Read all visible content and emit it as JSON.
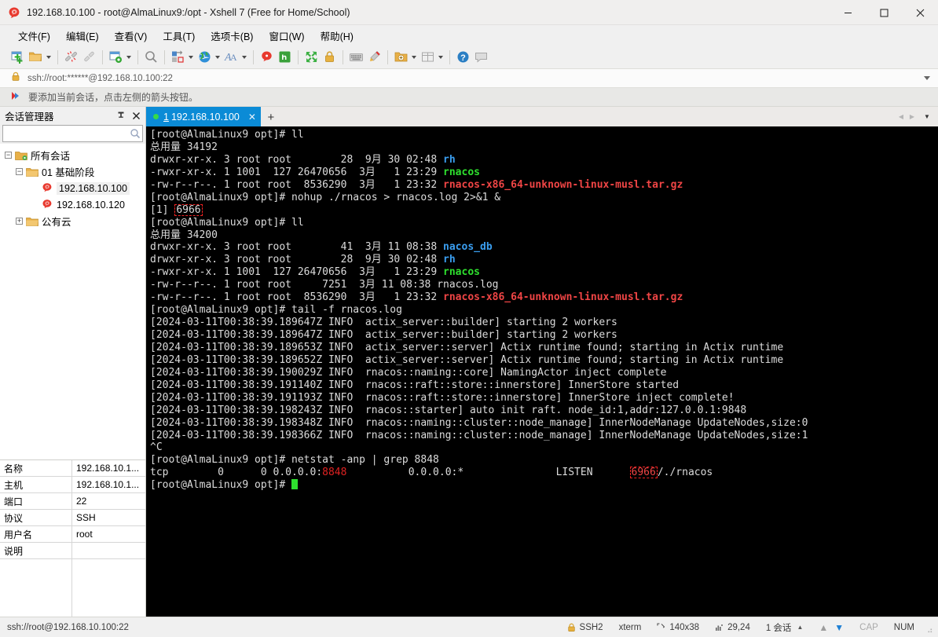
{
  "window": {
    "title": "192.168.10.100 - root@AlmaLinux9:/opt - Xshell 7 (Free for Home/School)",
    "minimize": "—",
    "maximize": "▢",
    "close": "✕"
  },
  "menubar": {
    "items": [
      {
        "label": "文件(F)",
        "name": "menu-file"
      },
      {
        "label": "编辑(E)",
        "name": "menu-edit"
      },
      {
        "label": "查看(V)",
        "name": "menu-view"
      },
      {
        "label": "工具(T)",
        "name": "menu-tools"
      },
      {
        "label": "选项卡(B)",
        "name": "menu-tabs"
      },
      {
        "label": "窗口(W)",
        "name": "menu-window"
      },
      {
        "label": "帮助(H)",
        "name": "menu-help"
      }
    ]
  },
  "toolbar": {
    "icons": [
      "new-session-icon",
      "open-folder-icon",
      "disconnect-icon",
      "reconnect-icon",
      "session-properties-icon",
      "find-icon",
      "transfer-icon",
      "globe-icon",
      "font-icon",
      "xshell-icon",
      "xftp-icon",
      "fullscreen-icon",
      "lock-icon",
      "keyboard-icon",
      "highlight-icon",
      "add-to-folder-icon",
      "layout-icon",
      "help-icon",
      "feedback-icon"
    ]
  },
  "address_bar": {
    "value": "ssh://root:******@192.168.10.100:22",
    "lock_icon": "lock-icon"
  },
  "notice_bar": {
    "text": "要添加当前会话，点击左侧的箭头按钮。",
    "icon": "red-arrow-icon"
  },
  "session_manager": {
    "title": "会话管理器",
    "pin_label": "⊓",
    "close_label": "✕",
    "search_placeholder": "",
    "search_value": "",
    "tree": [
      {
        "label": "所有会话",
        "type": "root-folder",
        "expander": "−",
        "name": "tree-node-all-sessions"
      },
      {
        "label": "01 基础阶段",
        "type": "folder",
        "expander": "−",
        "name": "tree-node-basic-stage"
      },
      {
        "label": "192.168.10.100",
        "type": "session",
        "expander": "",
        "selected": true,
        "name": "tree-node-session-100"
      },
      {
        "label": "192.168.10.120",
        "type": "session",
        "expander": "",
        "selected": false,
        "name": "tree-node-session-120"
      },
      {
        "label": "公有云",
        "type": "folder",
        "expander": "+",
        "name": "tree-node-public-cloud"
      }
    ],
    "properties": [
      {
        "key": "名称",
        "value": "192.168.10.1..."
      },
      {
        "key": "主机",
        "value": "192.168.10.1..."
      },
      {
        "key": "端口",
        "value": "22"
      },
      {
        "key": "协议",
        "value": "SSH"
      },
      {
        "key": "用户名",
        "value": "root"
      },
      {
        "key": "说明",
        "value": ""
      }
    ]
  },
  "tabs": {
    "active": {
      "number": "1",
      "label": "192.168.10.100",
      "close": "✕"
    },
    "add_label": "+",
    "left_arrow": "◀",
    "right_arrow": "▶",
    "dropdown": "▼"
  },
  "terminal": {
    "lines": [
      {
        "segs": [
          {
            "t": "[root@AlmaLinux9 opt]# ll",
            "c": "c-white"
          }
        ]
      },
      {
        "segs": [
          {
            "t": "总用量 34192",
            "c": "c-white"
          }
        ]
      },
      {
        "segs": [
          {
            "t": "drwxr-xr-x. 3 root root        28  9月 30 02:48 ",
            "c": "c-white"
          },
          {
            "t": "rh",
            "c": "c-blue"
          }
        ]
      },
      {
        "segs": [
          {
            "t": "-rwxr-xr-x. 1 1001  127 26470656  3月   1 23:29 ",
            "c": "c-white"
          },
          {
            "t": "rnacos",
            "c": "c-green"
          }
        ]
      },
      {
        "segs": [
          {
            "t": "-rw-r--r--. 1 root root  8536290  3月   1 23:32 ",
            "c": "c-white"
          },
          {
            "t": "rnacos-x86_64-unknown-linux-musl.tar.gz",
            "c": "c-red"
          }
        ]
      },
      {
        "segs": [
          {
            "t": "[root@AlmaLinux9 opt]# nohup ./rnacos > rnacos.log 2>&1 &",
            "c": "c-white"
          }
        ]
      },
      {
        "segs": [
          {
            "t": "[1] ",
            "c": "c-white"
          },
          {
            "t": "6966",
            "c": "c-white",
            "box": true
          }
        ]
      },
      {
        "segs": [
          {
            "t": "[root@AlmaLinux9 opt]# ll",
            "c": "c-white"
          }
        ]
      },
      {
        "segs": [
          {
            "t": "总用量 34200",
            "c": "c-white"
          }
        ]
      },
      {
        "segs": [
          {
            "t": "drwxr-xr-x. 3 root root        41  3月 11 08:38 ",
            "c": "c-white"
          },
          {
            "t": "nacos_db",
            "c": "c-blue"
          }
        ]
      },
      {
        "segs": [
          {
            "t": "drwxr-xr-x. 3 root root        28  9月 30 02:48 ",
            "c": "c-white"
          },
          {
            "t": "rh",
            "c": "c-blue"
          }
        ]
      },
      {
        "segs": [
          {
            "t": "-rwxr-xr-x. 1 1001  127 26470656  3月   1 23:29 ",
            "c": "c-white"
          },
          {
            "t": "rnacos",
            "c": "c-green"
          }
        ]
      },
      {
        "segs": [
          {
            "t": "-rw-r--r--. 1 root root     7251  3月 11 08:38 rnacos.log",
            "c": "c-white"
          }
        ]
      },
      {
        "segs": [
          {
            "t": "-rw-r--r--. 1 root root  8536290  3月   1 23:32 ",
            "c": "c-white"
          },
          {
            "t": "rnacos-x86_64-unknown-linux-musl.tar.gz",
            "c": "c-red"
          }
        ]
      },
      {
        "segs": [
          {
            "t": "[root@AlmaLinux9 opt]# tail -f rnacos.log",
            "c": "c-white"
          }
        ]
      },
      {
        "segs": [
          {
            "t": "[2024-03-11T00:38:39.189647Z INFO  actix_server::builder] starting 2 workers",
            "c": "c-white"
          }
        ]
      },
      {
        "segs": [
          {
            "t": "[2024-03-11T00:38:39.189647Z INFO  actix_server::builder] starting 2 workers",
            "c": "c-white"
          }
        ]
      },
      {
        "segs": [
          {
            "t": "[2024-03-11T00:38:39.189653Z INFO  actix_server::server] Actix runtime found; starting in Actix runtime",
            "c": "c-white"
          }
        ]
      },
      {
        "segs": [
          {
            "t": "[2024-03-11T00:38:39.189652Z INFO  actix_server::server] Actix runtime found; starting in Actix runtime",
            "c": "c-white"
          }
        ]
      },
      {
        "segs": [
          {
            "t": "[2024-03-11T00:38:39.190029Z INFO  rnacos::naming::core] NamingActor inject complete",
            "c": "c-white"
          }
        ]
      },
      {
        "segs": [
          {
            "t": "[2024-03-11T00:38:39.191140Z INFO  rnacos::raft::store::innerstore] InnerStore started",
            "c": "c-white"
          }
        ]
      },
      {
        "segs": [
          {
            "t": "[2024-03-11T00:38:39.191193Z INFO  rnacos::raft::store::innerstore] InnerStore inject complete!",
            "c": "c-white"
          }
        ]
      },
      {
        "segs": [
          {
            "t": "[2024-03-11T00:38:39.198243Z INFO  rnacos::starter] auto init raft. node_id:1,addr:127.0.0.1:9848",
            "c": "c-white"
          }
        ]
      },
      {
        "segs": [
          {
            "t": "[2024-03-11T00:38:39.198348Z INFO  rnacos::naming::cluster::node_manage] InnerNodeManage UpdateNodes,size:0",
            "c": "c-white"
          }
        ]
      },
      {
        "segs": [
          {
            "t": "[2024-03-11T00:38:39.198366Z INFO  rnacos::naming::cluster::node_manage] InnerNodeManage UpdateNodes,size:1",
            "c": "c-white"
          }
        ]
      },
      {
        "segs": [
          {
            "t": "^C",
            "c": "c-white"
          }
        ]
      },
      {
        "segs": [
          {
            "t": "[root@AlmaLinux9 opt]# netstat -anp | grep 8848",
            "c": "c-white"
          }
        ]
      },
      {
        "segs": [
          {
            "t": "tcp        0      0 0.0.0.0:",
            "c": "c-white"
          },
          {
            "t": "8848",
            "c": "c-redp"
          },
          {
            "t": "          0.0.0.0:*               LISTEN      ",
            "c": "c-white"
          },
          {
            "t": "6966",
            "c": "c-redp",
            "box": true
          },
          {
            "t": "/./rnacos",
            "c": "c-white"
          }
        ]
      },
      {
        "segs": [
          {
            "t": "[root@AlmaLinux9 opt]# ",
            "c": "c-white"
          },
          {
            "t": "",
            "cursor": true
          }
        ]
      }
    ]
  },
  "statusbar": {
    "left": "ssh://root@192.168.10.100:22",
    "protocol": "SSH2",
    "termtype": "xterm",
    "size": "140x38",
    "cursor": "29,24",
    "sessions": "1 会话",
    "cap": "CAP",
    "num": "NUM",
    "lock_icon": "lock-icon",
    "resize_icon": "resize-icon",
    "cursor_icon": "cursor-pos-icon",
    "up_arrow": "▲",
    "down_arrow": "▼",
    "session_caret": "▲"
  }
}
